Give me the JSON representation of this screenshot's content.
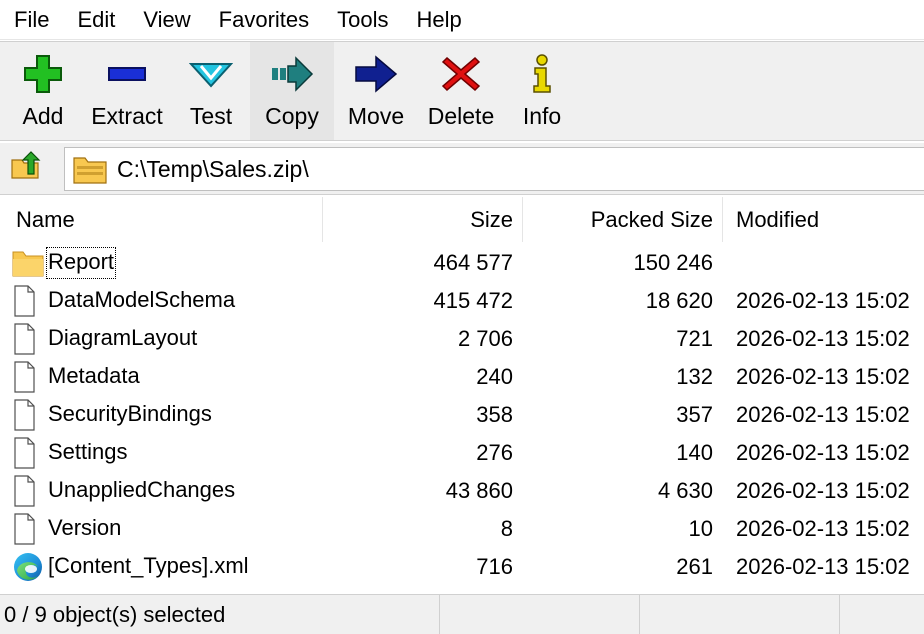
{
  "menu": [
    "File",
    "Edit",
    "View",
    "Favorites",
    "Tools",
    "Help"
  ],
  "toolbar": [
    {
      "label": "Add",
      "icon": "add-icon"
    },
    {
      "label": "Extract",
      "icon": "extract-icon"
    },
    {
      "label": "Test",
      "icon": "test-icon"
    },
    {
      "label": "Copy",
      "icon": "copy-icon"
    },
    {
      "label": "Move",
      "icon": "move-icon"
    },
    {
      "label": "Delete",
      "icon": "delete-icon"
    },
    {
      "label": "Info",
      "icon": "info-icon"
    }
  ],
  "address": {
    "path": "C:\\Temp\\Sales.zip\\"
  },
  "columns": {
    "name": "Name",
    "size": "Size",
    "packed": "Packed Size",
    "modified": "Modified"
  },
  "rows": [
    {
      "name": "Report",
      "size": "464 577",
      "packed": "150 246",
      "modified": "",
      "icon": "folder-icon"
    },
    {
      "name": "DataModelSchema",
      "size": "415 472",
      "packed": "18 620",
      "modified": "2026-02-13 15:02",
      "icon": "file-icon"
    },
    {
      "name": "DiagramLayout",
      "size": "2 706",
      "packed": "721",
      "modified": "2026-02-13 15:02",
      "icon": "file-icon"
    },
    {
      "name": "Metadata",
      "size": "240",
      "packed": "132",
      "modified": "2026-02-13 15:02",
      "icon": "file-icon"
    },
    {
      "name": "SecurityBindings",
      "size": "358",
      "packed": "357",
      "modified": "2026-02-13 15:02",
      "icon": "file-icon"
    },
    {
      "name": "Settings",
      "size": "276",
      "packed": "140",
      "modified": "2026-02-13 15:02",
      "icon": "file-icon"
    },
    {
      "name": "UnappliedChanges",
      "size": "43 860",
      "packed": "4 630",
      "modified": "2026-02-13 15:02",
      "icon": "file-icon"
    },
    {
      "name": "Version",
      "size": "8",
      "packed": "10",
      "modified": "2026-02-13 15:02",
      "icon": "file-icon"
    },
    {
      "name": "[Content_Types].xml",
      "size": "716",
      "packed": "261",
      "modified": "2026-02-13 15:02",
      "icon": "edge-xml-icon"
    }
  ],
  "status": {
    "selected": "0 / 9 object(s) selected",
    "seg2": "",
    "seg3": "",
    "seg4": ""
  },
  "colors": {
    "add": "#22c022",
    "extract": "#1a2fd6",
    "test": "#22c4e0",
    "copy": "#1f7f7f",
    "move": "#102090",
    "delete": "#e01010",
    "info": "#e8d800",
    "folder": "#f8c850"
  }
}
